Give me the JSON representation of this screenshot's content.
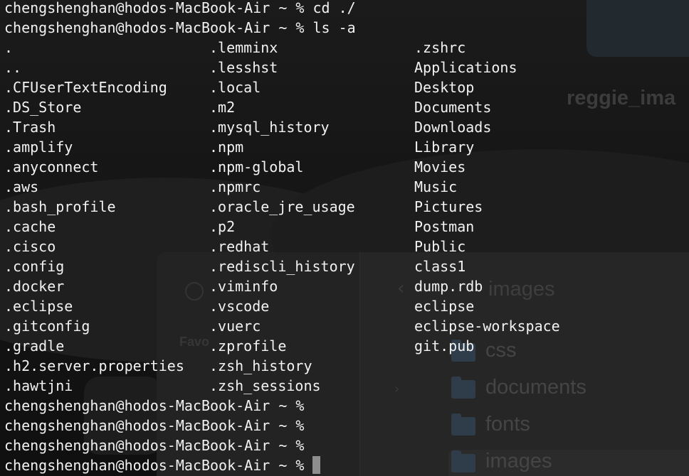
{
  "background": {
    "wallpaper_label": "reggie_ima",
    "finder": {
      "sidebar_label": "Favo",
      "back_icon": "chevron-left-icon",
      "title": "images",
      "folders": [
        "css",
        "documents",
        "fonts",
        "images"
      ]
    }
  },
  "terminal": {
    "prompt": "chengshenghan@hodos-MacBook-Air ~ %",
    "commands": [
      {
        "prompt": "chengshenghan@hodos-MacBook-Air ~ %",
        "text": "cd ./"
      },
      {
        "prompt": "chengshenghan@hodos-MacBook-Air ~ %",
        "text": "ls -a"
      }
    ],
    "listing": {
      "columns": [
        [
          ".",
          "..",
          ".CFUserTextEncoding",
          ".DS_Store",
          ".Trash",
          ".amplify",
          ".anyconnect",
          ".aws",
          ".bash_profile",
          ".cache",
          ".cisco",
          ".config",
          ".docker",
          ".eclipse",
          ".gitconfig",
          ".gradle",
          ".h2.server.properties",
          ".hawtjni"
        ],
        [
          ".lemminx",
          ".lesshst",
          ".local",
          ".m2",
          ".mysql_history",
          ".npm",
          ".npm-global",
          ".npmrc",
          ".oracle_jre_usage",
          ".p2",
          ".redhat",
          ".rediscli_history",
          ".viminfo",
          ".vscode",
          ".vuerc",
          ".zprofile",
          ".zsh_history",
          ".zsh_sessions"
        ],
        [
          ".zshrc",
          "Applications",
          "Desktop",
          "Documents",
          "Downloads",
          "Library",
          "Movies",
          "Music",
          "Pictures",
          "Postman",
          "Public",
          "class1",
          "dump.rdb",
          "eclipse",
          "eclipse-workspace",
          "git.pub"
        ]
      ]
    },
    "trailing_prompts": [
      "chengshenghan@hodos-MacBook-Air ~ %",
      "chengshenghan@hodos-MacBook-Air ~ %",
      "chengshenghan@hodos-MacBook-Air ~ %",
      "chengshenghan@hodos-MacBook-Air ~ %"
    ],
    "colors": {
      "text": "#f2f2f2",
      "cursor": "#8e8e8e"
    }
  }
}
